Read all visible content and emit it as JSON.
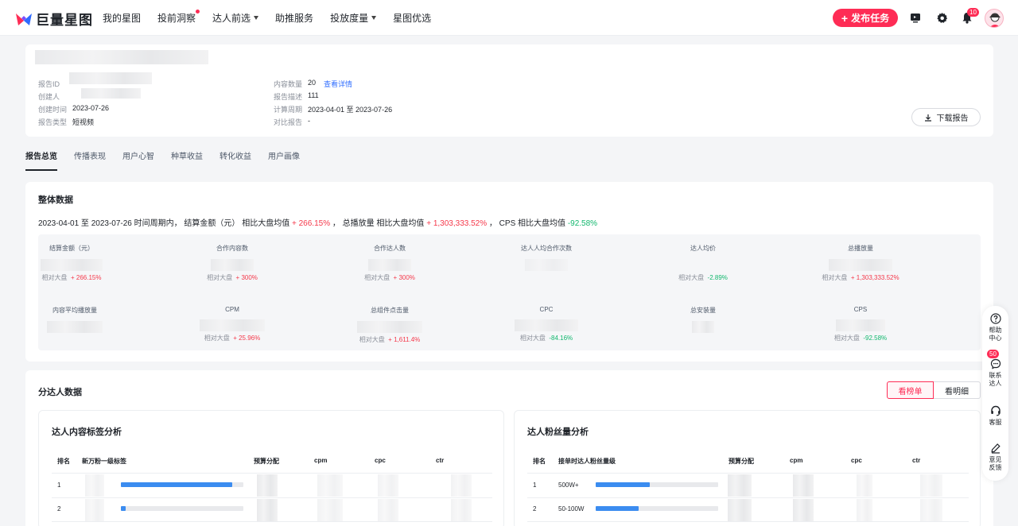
{
  "brand": {
    "name": "巨量星图",
    "accent": "#fe2c55"
  },
  "nav": [
    {
      "label": "我的星图",
      "dot": false,
      "caret": false
    },
    {
      "label": "投前洞察",
      "dot": true,
      "caret": false
    },
    {
      "label": "达人前选",
      "dot": false,
      "caret": true
    },
    {
      "label": "助推服务",
      "dot": false,
      "caret": false
    },
    {
      "label": "投放度量",
      "dot": false,
      "caret": true
    },
    {
      "label": "星图优选",
      "dot": false,
      "caret": false
    }
  ],
  "topbar": {
    "publish_label": "发布任务",
    "notify_count": "10"
  },
  "report": {
    "meta_left": [
      {
        "label": "报告ID",
        "value": ""
      },
      {
        "label": "创建人",
        "value": ""
      },
      {
        "label": "创建时间",
        "value": "2023-07-26"
      },
      {
        "label": "报告类型",
        "value": "短视频"
      }
    ],
    "meta_right": [
      {
        "label": "内容数量",
        "value": "20",
        "link": "查看详情"
      },
      {
        "label": "报告描述",
        "value": "111",
        "link": ""
      },
      {
        "label": "计算周期",
        "value": "2023-04-01 至 2023-07-26",
        "link": ""
      },
      {
        "label": "对比报告",
        "value": "-",
        "link": ""
      }
    ],
    "download_label": "下载报告"
  },
  "tabs": [
    "报告总览",
    "传播表现",
    "用户心智",
    "种草收益",
    "转化收益",
    "用户画像"
  ],
  "overview": {
    "title": "整体数据",
    "summary": {
      "p1": "2023-04-01 至 2023-07-26 时间周期内，  结算金额（元） 相比大盘均值 ",
      "v1": "+ 266.15%",
      "p2": " ，  总播放量 相比大盘均值 ",
      "v2": "+ 1,303,333.52%",
      "p3": " ，  CPS 相比大盘均值 ",
      "v3": "-92.58%"
    },
    "compare_label": "相对大盘",
    "metrics": [
      {
        "label": "结算金额（元）",
        "cmp": "+ 266.15%",
        "dir": "up"
      },
      {
        "label": "合作内容数",
        "cmp": "+ 300%",
        "dir": "up"
      },
      {
        "label": "合作达人数",
        "cmp": "+ 300%",
        "dir": "up"
      },
      {
        "label": "达人人均合作次数",
        "cmp": "",
        "dir": ""
      },
      {
        "label": "达人均价",
        "cmp": "-2.89%",
        "dir": "down"
      },
      {
        "label": "总播放量",
        "cmp": "+ 1,303,333.52%",
        "dir": "up"
      },
      {
        "label": "内容平均播放量",
        "cmp": "",
        "dir": ""
      },
      {
        "label": "CPM",
        "cmp": "+ 25.96%",
        "dir": "up"
      },
      {
        "label": "总组件点击量",
        "cmp": "+ 1,611.4%",
        "dir": "up"
      },
      {
        "label": "CPC",
        "cmp": "-84.16%",
        "dir": "down"
      },
      {
        "label": "总安装量",
        "cmp": "",
        "dir": ""
      },
      {
        "label": "CPS",
        "cmp": "-92.58%",
        "dir": "down"
      }
    ]
  },
  "kol": {
    "title": "分达人数据",
    "toggle": [
      "看榜单",
      "看明细"
    ],
    "content_tag": {
      "title": "达人内容标签分析",
      "headers": [
        "排名",
        "新万粉一级标签",
        "预算分配",
        "cpm",
        "cpc",
        "ctr"
      ],
      "rows": [
        {
          "rank": "1",
          "label": "",
          "share": 0.91
        },
        {
          "rank": "2",
          "label": "",
          "share": 0.04
        }
      ]
    },
    "fans": {
      "title": "达人粉丝量分析",
      "headers": [
        "排名",
        "接单时达人粉丝量级",
        "预算分配",
        "cpm",
        "cpc",
        "ctr"
      ],
      "rows": [
        {
          "rank": "1",
          "label": "500W+",
          "share": 0.44
        },
        {
          "rank": "2",
          "label": "50-100W",
          "share": 0.35
        }
      ]
    }
  },
  "side": [
    {
      "label": "帮助中心",
      "icon": "help-icon"
    },
    {
      "label": "联系达人",
      "icon": "chat-icon",
      "badge": "50"
    },
    {
      "label": "客服",
      "icon": "headset-icon"
    },
    {
      "label": "意见反馈",
      "icon": "edit-icon"
    }
  ]
}
